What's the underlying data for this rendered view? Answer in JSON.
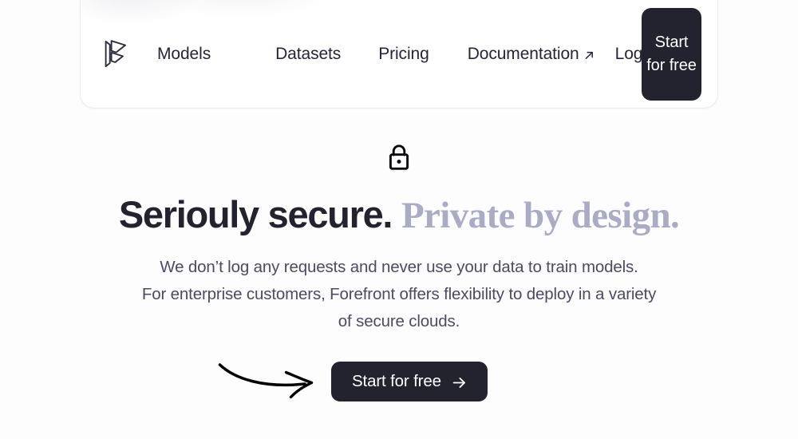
{
  "page": {
    "background_color": "#fdfdfe",
    "text_color": "#23232f",
    "accent_serif_color": "#aaabc4",
    "button_color": "#22232e"
  },
  "nav": {
    "logo_alt": "Forefront logo",
    "links": [
      {
        "label": "Models",
        "external": false
      },
      {
        "label": "Datasets",
        "external": false
      },
      {
        "label": "Pricing",
        "external": false
      },
      {
        "label": "Documentation",
        "external": true
      },
      {
        "label": "Login",
        "external": false
      }
    ],
    "cta_label": "Start for free"
  },
  "hero": {
    "icon": "lock-icon",
    "headline_primary": "Seriouly secure.",
    "headline_accent": "Private by design.",
    "subcopy_lines": [
      "We don’t log any requests and never use your data to train models.",
      "For enterprise customers, Forefront offers flexibility to deploy in a variety",
      "of secure clouds."
    ],
    "cta_label": "Start for free",
    "cta_arrow": "arrow-right-icon",
    "doodle": "curved-arrow-doodle"
  }
}
